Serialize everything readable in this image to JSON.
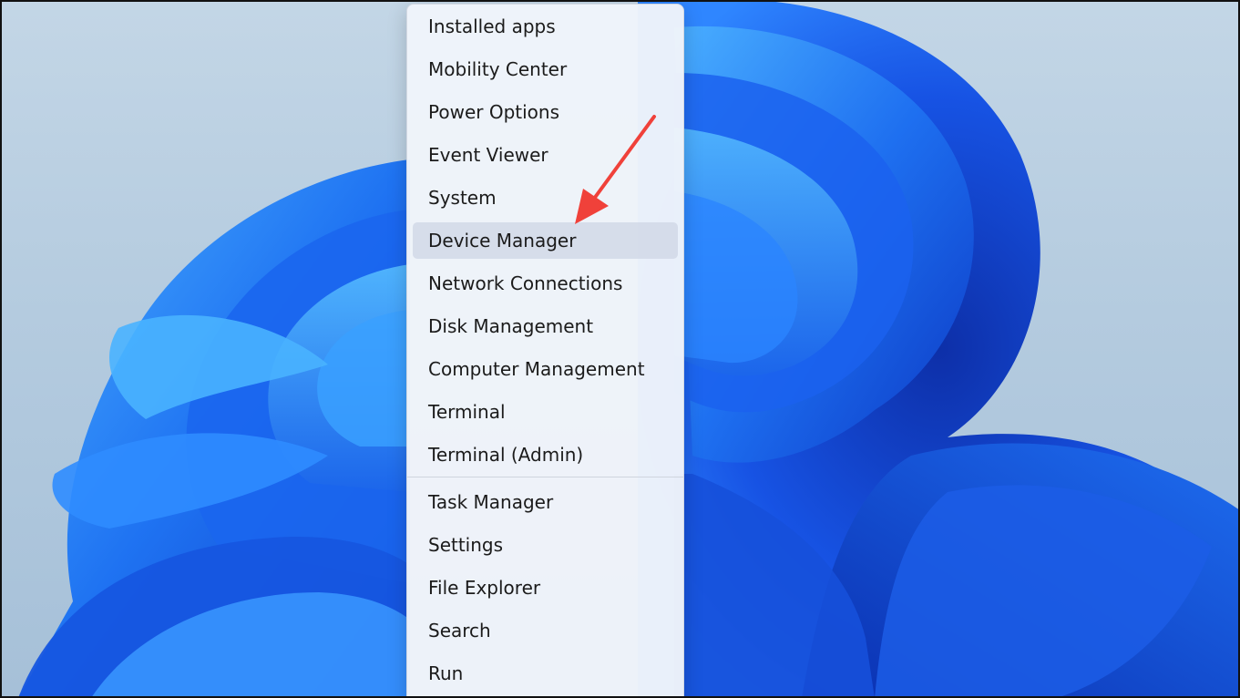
{
  "menu": {
    "items": [
      {
        "label": "Installed apps"
      },
      {
        "label": "Mobility Center"
      },
      {
        "label": "Power Options"
      },
      {
        "label": "Event Viewer"
      },
      {
        "label": "System"
      },
      {
        "label": "Device Manager",
        "highlighted": true
      },
      {
        "label": "Network Connections"
      },
      {
        "label": "Disk Management"
      },
      {
        "label": "Computer Management"
      },
      {
        "label": "Terminal"
      },
      {
        "label": "Terminal (Admin)"
      }
    ],
    "items_lower": [
      {
        "label": "Task Manager"
      },
      {
        "label": "Settings"
      },
      {
        "label": "File Explorer"
      },
      {
        "label": "Search"
      },
      {
        "label": "Run"
      }
    ]
  },
  "colors": {
    "bloom_dark": "#0b3fd6",
    "bloom_mid": "#1a6cf0",
    "bloom_light": "#3ea3ff",
    "annotation_arrow": "#f0413a"
  },
  "annotation": {
    "icon": "red-arrow-icon",
    "points_to": "Device Manager"
  }
}
